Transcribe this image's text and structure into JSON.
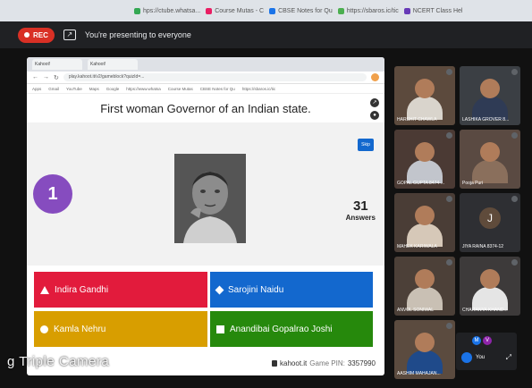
{
  "host_tabs": [
    {
      "label": "hps://ctube.whatsa...",
      "color": "#34a853"
    },
    {
      "label": "Course Mutas - C",
      "color": "#e91e63"
    },
    {
      "label": "CBSE Notes for Qu",
      "color": "#1a73e8"
    },
    {
      "label": "https://sbaros.ic/tic",
      "color": "#4caf50"
    },
    {
      "label": "NCERT Class Hel",
      "color": "#673ab7"
    }
  ],
  "meet": {
    "rec_label": "REC",
    "presenting_text": "You're presenting to everyone"
  },
  "inner_browser": {
    "tab1": "Kahoot!",
    "tab2": "Kahoot!",
    "url": "play.kahoot.it/v2/gameblock?quizId=...",
    "bookmarks": [
      "Apps",
      "Gmail",
      "YouTube",
      "Maps",
      "Google",
      "https://www.whatsa",
      "Course Mutas",
      "CBSE Notes for Qu",
      "https://sbaros.ic/tic"
    ]
  },
  "quiz": {
    "question": "First woman Governor of an Indian state.",
    "skip": "Skip",
    "timer": "1",
    "answers_count": "31",
    "answers_label": "Answers",
    "options": [
      {
        "label": "Indira Gandhi",
        "shape": "triangle",
        "color": "#e21b3c"
      },
      {
        "label": "Sarojini Naidu",
        "shape": "diamond",
        "color": "#1368ce"
      },
      {
        "label": "Kamla Nehru",
        "shape": "circle",
        "color": "#d89e00"
      },
      {
        "label": "Anandibai Gopalrao Joshi",
        "shape": "square",
        "color": "#26890c"
      }
    ],
    "footer_site": "kahoot.it",
    "footer_pin_label": "Game PIN:",
    "footer_pin": "3357990"
  },
  "camera_label": "g Triple Camera",
  "participants": [
    {
      "name": "HARSHIT CHAWLA",
      "bg": "#5c4a3d",
      "body": "#d9d4cc"
    },
    {
      "name": "LASHIKA GROVER 8...",
      "bg": "#3b3f44",
      "body": "#2f3b55"
    },
    {
      "name": "GOPAL GUPTA 8474-...",
      "bg": "#4b3a34",
      "body": "#c2c5cc"
    },
    {
      "name": "Pooja Puri",
      "bg": "#5a4a42",
      "body": "#8a6f5c"
    },
    {
      "name": "MAHEK KARIWALA",
      "bg": "#4a3d36",
      "body": "#d6c8b8"
    },
    {
      "name": "JIYA RAINA 8374-12",
      "bg": "#2e2f33",
      "body": "#2e2f33",
      "letter": "J"
    },
    {
      "name": "ANVOL SONIWAL",
      "bg": "#4c4038",
      "body": "#c9c0b4"
    },
    {
      "name": "CHAITANYA KHAND...",
      "bg": "#3d3a3a",
      "body": "#e5e5e5"
    },
    {
      "name": "AASHIM MAHAJAN...",
      "bg": "#5b4b3f",
      "body": "#1f4a8a"
    }
  ],
  "controls": {
    "mini_avatars": [
      {
        "letter": "M",
        "color": "#1a73e8"
      },
      {
        "letter": "V",
        "color": "#8e24aa"
      }
    ],
    "you": "You"
  }
}
